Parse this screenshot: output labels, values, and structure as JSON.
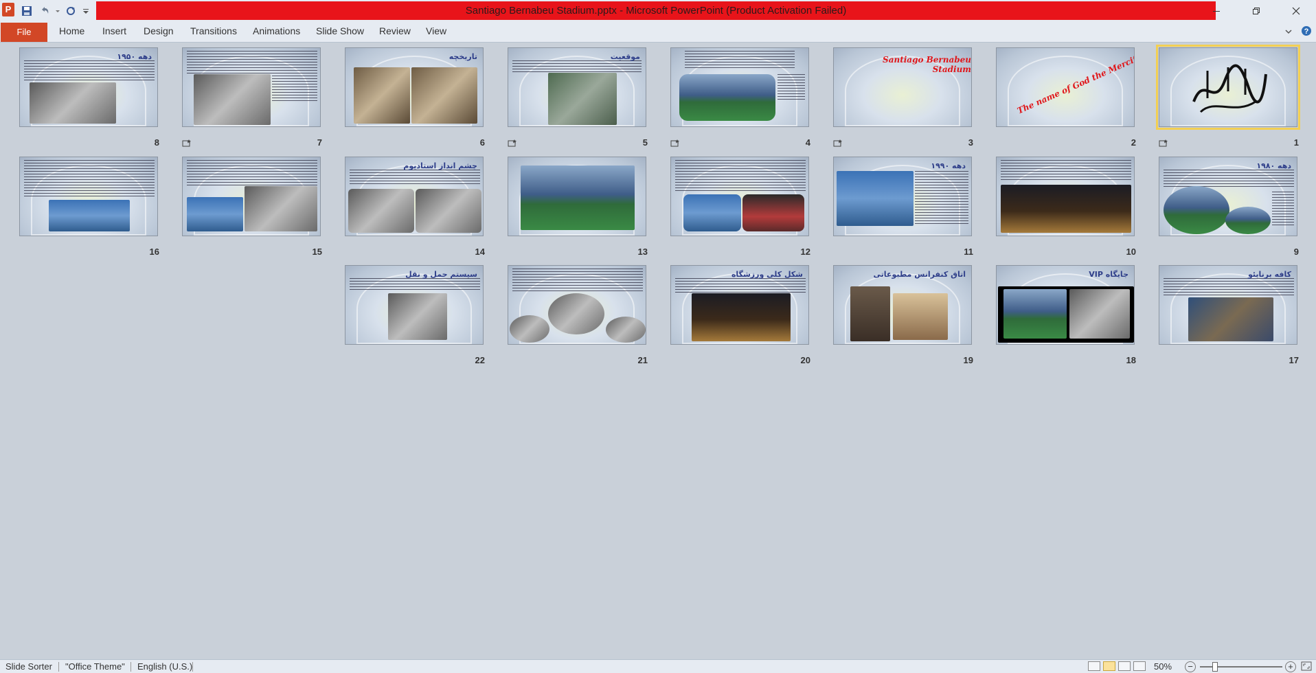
{
  "window": {
    "title": "Santiago Bernabeu Stadium.pptx  -  Microsoft PowerPoint (Product Activation Failed)",
    "app_icon_letter": "P"
  },
  "ribbon": {
    "file": "File",
    "tabs": [
      "Home",
      "Insert",
      "Design",
      "Transitions",
      "Animations",
      "Slide Show",
      "Review",
      "View"
    ]
  },
  "slides": [
    {
      "num": "1",
      "title": "",
      "type": "calligraphy",
      "transition": true,
      "selected": true
    },
    {
      "num": "2",
      "title": "The name of God the Merciful",
      "type": "diag-red",
      "transition": false
    },
    {
      "num": "3",
      "title": "Santiago Bernabeu Stadium",
      "type": "red-title",
      "transition": true
    },
    {
      "num": "4",
      "title": "",
      "type": "text-photo-bottom",
      "transition": true
    },
    {
      "num": "5",
      "title": "موقعیت",
      "type": "text-photo-center",
      "transition": true
    },
    {
      "num": "6",
      "title": "تاریخچه",
      "type": "title-photos",
      "transition": false
    },
    {
      "num": "7",
      "title": "",
      "type": "text-photo-left",
      "transition": true
    },
    {
      "num": "8",
      "title": "دهه ۱۹۵۰",
      "type": "title-text-photo",
      "transition": false
    },
    {
      "num": "9",
      "title": "دهه ۱۹۸۰",
      "type": "title-text-ovals",
      "transition": false
    },
    {
      "num": "10",
      "title": "",
      "type": "text-photo-wide",
      "transition": false
    },
    {
      "num": "11",
      "title": "دهه ۱۹۹۰",
      "type": "title-photo-left-text",
      "transition": false
    },
    {
      "num": "12",
      "title": "",
      "type": "text-two-photos",
      "transition": false
    },
    {
      "num": "13",
      "title": "",
      "type": "big-photo",
      "transition": false
    },
    {
      "num": "14",
      "title": "چشم انداز استادیوم",
      "type": "title-two-photos",
      "transition": false
    },
    {
      "num": "15",
      "title": "",
      "type": "text-two-photos-b",
      "transition": false
    },
    {
      "num": "16",
      "title": "",
      "type": "text-photo-bottom-b",
      "transition": false
    },
    {
      "num": "17",
      "title": "کافه برنابئو",
      "type": "title-text-photo-b",
      "transition": false
    },
    {
      "num": "18",
      "title": "جایگاه VIP",
      "type": "title-black-photos",
      "transition": false
    },
    {
      "num": "19",
      "title": "اتاق کنفرانس مطبوعاتی",
      "type": "title-two-photos-c",
      "transition": false
    },
    {
      "num": "20",
      "title": "شکل کلی ورزشگاه",
      "type": "title-text-photo-night",
      "transition": false
    },
    {
      "num": "21",
      "title": "",
      "type": "text-ovals",
      "transition": false
    },
    {
      "num": "22",
      "title": "سیستم حمل و نقل",
      "type": "title-text-photo-c",
      "transition": false
    }
  ],
  "statusbar": {
    "view_name": "Slide Sorter",
    "theme": "\"Office Theme\"",
    "language": "English (U.S.)",
    "zoom": "50%"
  },
  "colors": {
    "title_bar_red": "#e8141a",
    "file_tab": "#d24726",
    "selection": "#f2cf53",
    "sorter_bg": "#c9d0d9"
  }
}
